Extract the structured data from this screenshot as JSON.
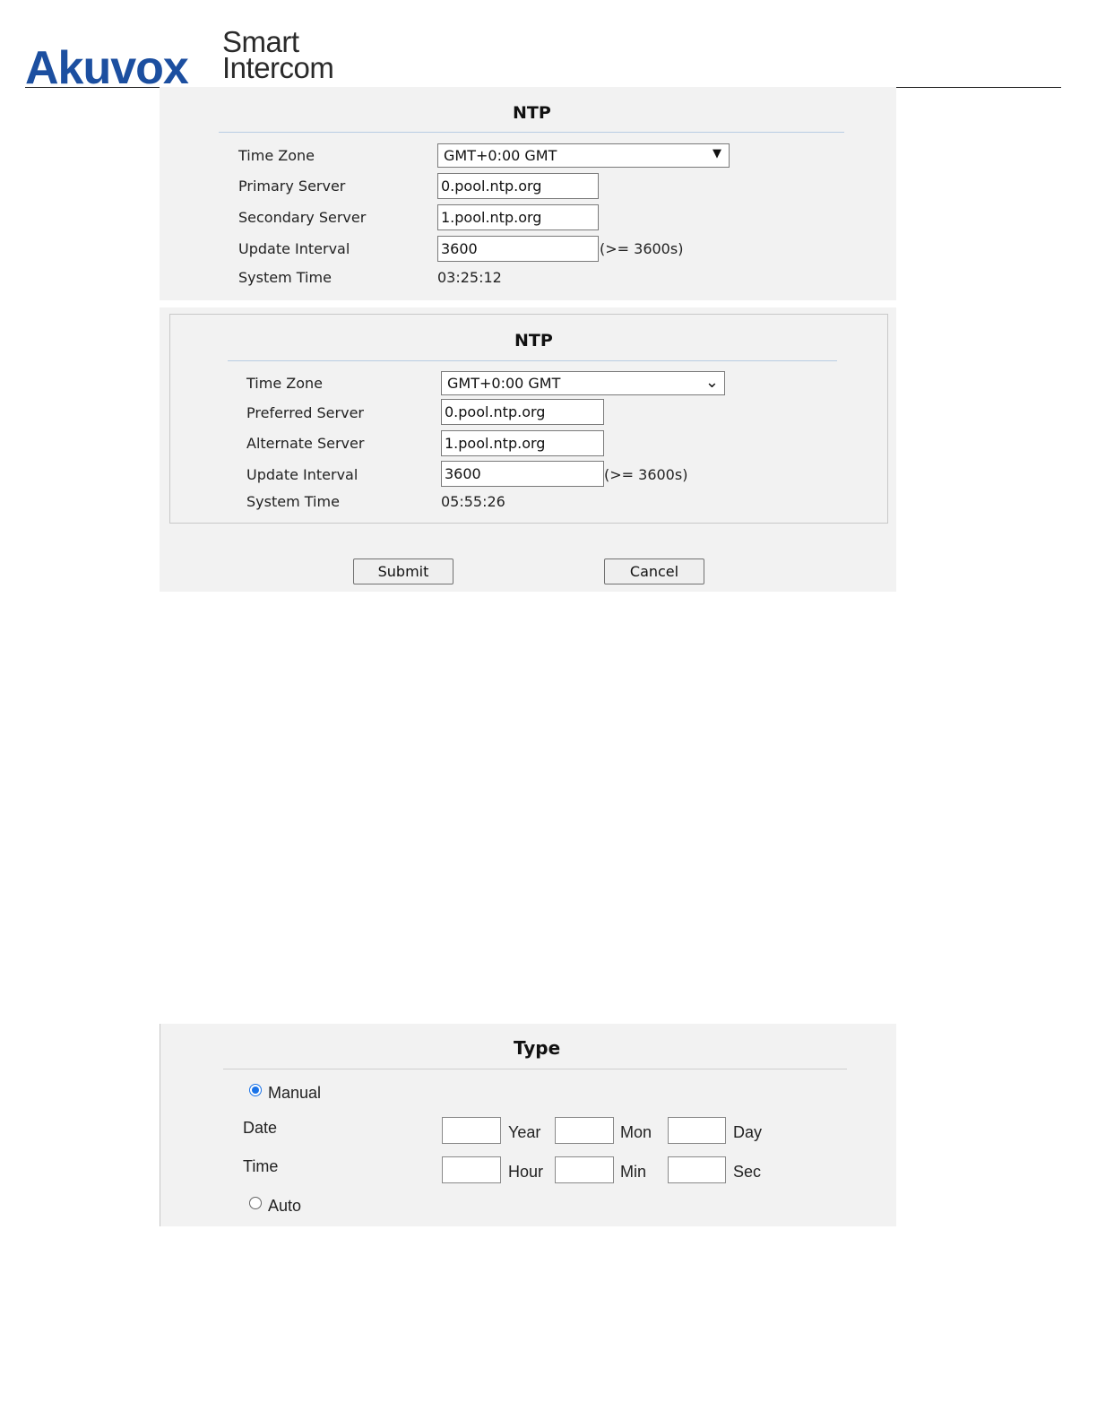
{
  "header": {
    "brand": "Akuvox",
    "tagline_line1": "Smart",
    "tagline_line2": "Intercom"
  },
  "ntp1": {
    "title": "NTP",
    "time_zone_label": "Time Zone",
    "time_zone_value": "GMT+0:00 GMT",
    "primary_server_label": "Primary Server",
    "primary_server_value": "0.pool.ntp.org",
    "secondary_server_label": "Secondary Server",
    "secondary_server_value": "1.pool.ntp.org",
    "update_interval_label": "Update Interval",
    "update_interval_value": "3600",
    "update_interval_hint": "(>= 3600s)",
    "system_time_label": "System Time",
    "system_time_value": "03:25:12"
  },
  "ntp2": {
    "title": "NTP",
    "time_zone_label": "Time Zone",
    "time_zone_value": "GMT+0:00 GMT",
    "preferred_server_label": "Preferred Server",
    "preferred_server_value": "0.pool.ntp.org",
    "alternate_server_label": "Alternate Server",
    "alternate_server_value": "1.pool.ntp.org",
    "update_interval_label": "Update Interval",
    "update_interval_value": "3600",
    "update_interval_hint": "(>= 3600s)",
    "system_time_label": "System Time",
    "system_time_value": "05:55:26",
    "submit_label": "Submit",
    "cancel_label": "Cancel"
  },
  "type_panel": {
    "title": "Type",
    "manual_label": "Manual",
    "manual_selected": true,
    "date_label": "Date",
    "time_label": "Time",
    "year_label": "Year",
    "mon_label": "Mon",
    "day_label": "Day",
    "hour_label": "Hour",
    "min_label": "Min",
    "sec_label": "Sec",
    "auto_label": "Auto",
    "auto_selected": false
  },
  "colors": {
    "brand_blue": "#1c4fa0",
    "panel_bg": "#f2f2f2",
    "rule": "#b8cde3",
    "radio_accent": "#1a73e8"
  }
}
